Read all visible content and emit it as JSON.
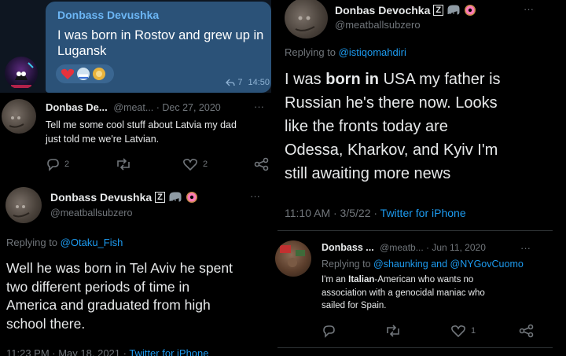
{
  "telegram": {
    "sender": "Donbass Devushka",
    "message": [
      "I was born in Rostov and grew up in",
      "Lugansk"
    ],
    "reply_count": "7",
    "time": "14:50",
    "accent": "#6cb6f5",
    "bubble_color": "#2b5278"
  },
  "tweet_latvia": {
    "name": "Donbas De...",
    "handle_date": "@meat... · Dec 27, 2020",
    "more": "···",
    "text": [
      "Tell me some cool stuff about Latvia my dad",
      "just told me we're Latvian."
    ],
    "reply_count": "2",
    "like_count": "2"
  },
  "tweet_telaviv": {
    "name": "Donbass Devushka",
    "badge": "Z",
    "handle": "@meatballsubzero",
    "more": "···",
    "replying_prefix": "Replying to",
    "replying_to": "@Otaku_Fish",
    "text": [
      "Well he was born in Tel Aviv he spent",
      "two different periods of time in",
      "America and graduated from high",
      "school there."
    ],
    "footer_time": "11:23 PM · May 18, 2021 · ",
    "footer_source": "Twitter for iPhone"
  },
  "tweet_usa": {
    "name": "Donbas Devochka",
    "badge": "Z",
    "handle": "@meatballsubzero",
    "more": "···",
    "replying_prefix": "Replying to",
    "replying_to": "@istiqomahdiri",
    "text_1a": "I was ",
    "text_1b": "born in",
    "text_1c": " USA my father is",
    "text_rest": [
      "Russian he's there now. Looks",
      "like the fronts today are",
      "Odessa, Kharkov, and Kyiv I'm",
      "still awaiting more news"
    ],
    "footer_time": "11:10 AM · 3/5/22 · ",
    "footer_source": "Twitter for iPhone"
  },
  "tweet_italian": {
    "name": "Donbass ...",
    "handle_date": "@meatb... · Jun 11, 2020",
    "more": "···",
    "replying_prefix": "Replying to",
    "replying_to_1": "@shaunking",
    "and": " and ",
    "replying_to_2": "@NYGovCuomo",
    "text_1a": "I'm an ",
    "text_1b": "Italian",
    "text_1c": "-American who wants no",
    "text_rest": [
      "association with a genocidal maniac who",
      "sailed for Spain."
    ],
    "like_count": "1"
  }
}
